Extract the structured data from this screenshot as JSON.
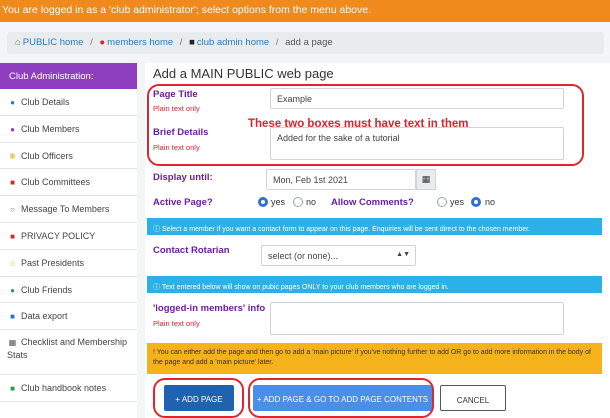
{
  "topbar": {
    "message": "You are logged in as a 'club administrator'; select options from the menu above."
  },
  "breadcrumb": [
    {
      "label": "PUBLIC home",
      "icon": "home-icon"
    },
    {
      "label": "members home",
      "icon": "user-icon"
    },
    {
      "label": "club admin home",
      "icon": "bank-icon"
    },
    {
      "label": "add a page"
    }
  ],
  "sidebar": {
    "title": "Club Administration:",
    "items": [
      {
        "label": "Club Details",
        "icon": "info-icon"
      },
      {
        "label": "Club Members",
        "icon": "users-icon"
      },
      {
        "label": "Club Officers",
        "icon": "gear-icon"
      },
      {
        "label": "Club Committees",
        "icon": "committee-icon"
      },
      {
        "label": "Message To Members",
        "icon": "chat-icon"
      },
      {
        "label": "PRIVACY POLICY",
        "icon": "lock-icon"
      },
      {
        "label": "Past Presidents",
        "icon": "star-icon"
      },
      {
        "label": "Club Friends",
        "icon": "friends-icon"
      },
      {
        "label": "Data export",
        "icon": "export-icon"
      },
      {
        "label": "Checklist and Membership Stats",
        "icon": "chart-icon"
      },
      {
        "label": "Club handbook notes",
        "icon": "book-icon"
      }
    ]
  },
  "form": {
    "heading": "Add a MAIN PUBLIC web page",
    "page_title_label": "Page Title",
    "page_title_hint": "Plain text only",
    "page_title_value": "Example",
    "brief_label": "Brief Details",
    "brief_hint": "Plain text only",
    "brief_value": "Added for the sake of a tutorial",
    "display_label": "Display until:",
    "display_value": "Mon, Feb 1st 2021",
    "active_label": "Active Page?",
    "active_yes": "yes",
    "active_no": "no",
    "comments_label": "Allow Comments?",
    "comments_yes": "yes",
    "comments_no": "no",
    "info_contact": "Select a member if you want a contact form to appear on this page. Enquiries will be sent direct to the chosen member.",
    "contact_label": "Contact Rotarian",
    "contact_value": "select (or none)...",
    "info_members": "Text entered below will show on pubic pages ONLY to your club members who are logged in.",
    "loggedin_label": "'logged-in members' info",
    "loggedin_hint": "Plain text only",
    "warning": "You can either add the page and then go to add a 'main picture' if you've nothing further to add OR go to add more information in the body of the page and add a 'main picture' later.",
    "btn_add": "ADD PAGE",
    "btn_add_go": "ADD PAGE & GO TO ADD PAGE CONTENTS",
    "btn_cancel": "CANCEL"
  },
  "annotation": {
    "note": "These two boxes must have text in them"
  }
}
